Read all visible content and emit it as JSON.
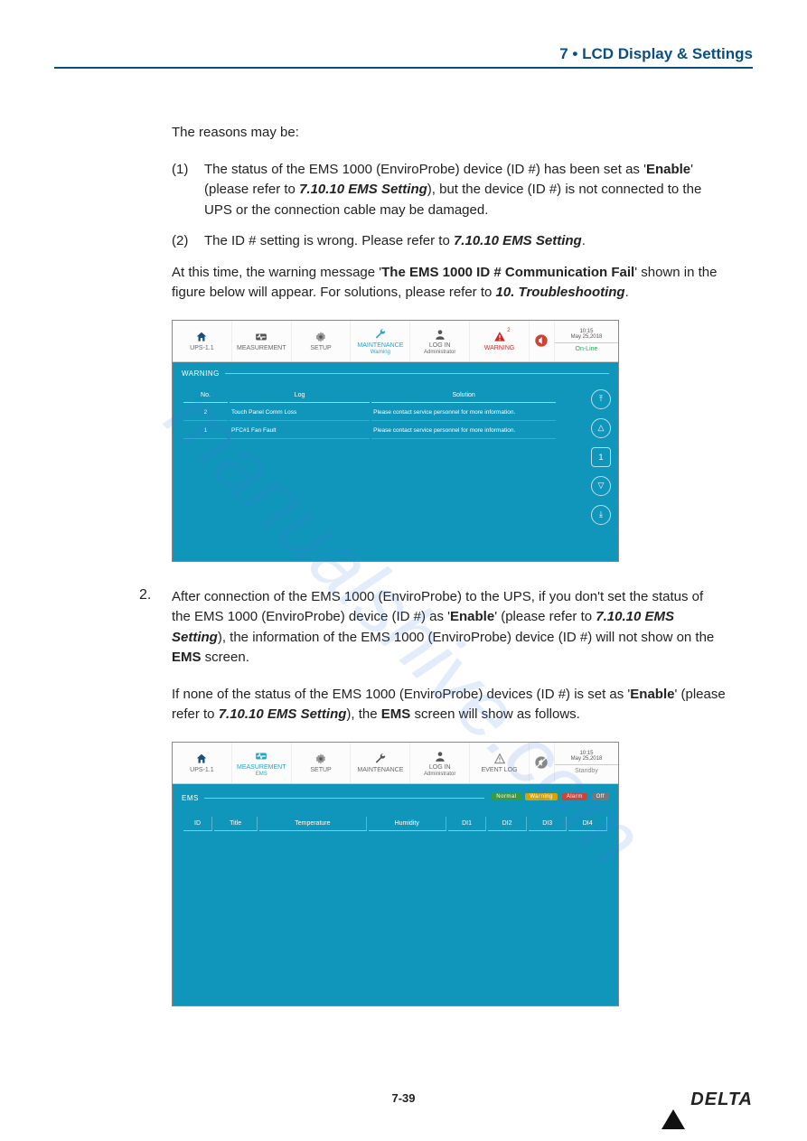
{
  "header": {
    "chapter": "7 • LCD Display & Settings"
  },
  "intro": "The reasons may be:",
  "reasons": [
    {
      "num": "(1)",
      "parts": [
        "The status of the EMS 1000 (EnviroProbe) device (ID #) has been set as '",
        "Enable",
        "' (please refer to ",
        "7.10.10 EMS Setting",
        "), but the device (ID #) is not connected to the UPS or the connection cable may be damaged."
      ]
    },
    {
      "num": "(2)",
      "parts": [
        "The ID # setting is wrong. Please refer to ",
        "7.10.10 EMS Setting",
        "."
      ]
    }
  ],
  "warn_para": [
    "At this time, the warning message '",
    "The EMS 1000 ID # Communication Fail",
    "' shown in the figure below will appear. For solutions, please refer to ",
    "10. Troubleshooting",
    "."
  ],
  "ui1": {
    "top": {
      "ups": "UPS-1.1",
      "measurement": "MEASUREMENT",
      "setup": "SETUP",
      "maintenance": "MAINTENANCE",
      "maint_sub": "Warning",
      "login": "LOG IN",
      "login_sub": "Administrator",
      "warning": "WARNING",
      "warning_badge": "2",
      "time": "10:15",
      "date": "May 25,2018",
      "status": "On-Line"
    },
    "section": "WARNING",
    "cols": {
      "no": "No.",
      "log": "Log",
      "solution": "Solution"
    },
    "rows": [
      {
        "no": "2",
        "log": "Touch Panel Comm Loss",
        "sol": "Please contact service personnel for more information."
      },
      {
        "no": "1",
        "log": "PFC#1 Fan Fault",
        "sol": "Please contact service personnel for more information."
      }
    ],
    "page": "1"
  },
  "para2_num": "2.",
  "para2": [
    "After connection of the EMS 1000 (EnviroProbe) to the UPS, if you don't set the status of the EMS 1000 (EnviroProbe) device (ID #) as '",
    "Enable",
    "' (please refer to ",
    "7.10.10 EMS Setting",
    "), the information of the EMS 1000 (EnviroProbe) device (ID #) will not show on the ",
    "EMS",
    " screen."
  ],
  "para3": [
    "If none of the status of the EMS 1000 (EnviroProbe) devices (ID #) is set as '",
    "Enable",
    "' (please refer to ",
    "7.10.10 EMS Setting",
    "), the ",
    "EMS",
    " screen will show as follows."
  ],
  "ui2": {
    "top": {
      "ups": "UPS-1.1",
      "measurement": "MEASUREMENT",
      "meas_sub": "EMS",
      "setup": "SETUP",
      "maintenance": "MAINTENANCE",
      "login": "LOG IN",
      "login_sub": "Administrator",
      "eventlog": "EVENT LOG",
      "time": "10:15",
      "date": "May 25,2018",
      "status": "Standby"
    },
    "section": "EMS",
    "badges": {
      "normal": "Normal",
      "warning": "Warning",
      "alarm": "Alarm",
      "off": "Off"
    },
    "cols": {
      "id": "ID",
      "title": "Title",
      "temp": "Temperature",
      "hum": "Humidity",
      "di1": "DI1",
      "di2": "DI2",
      "di3": "DI3",
      "di4": "DI4"
    }
  },
  "page_num": "7-39",
  "brand": "DELTA",
  "watermark": "manualshive.com"
}
